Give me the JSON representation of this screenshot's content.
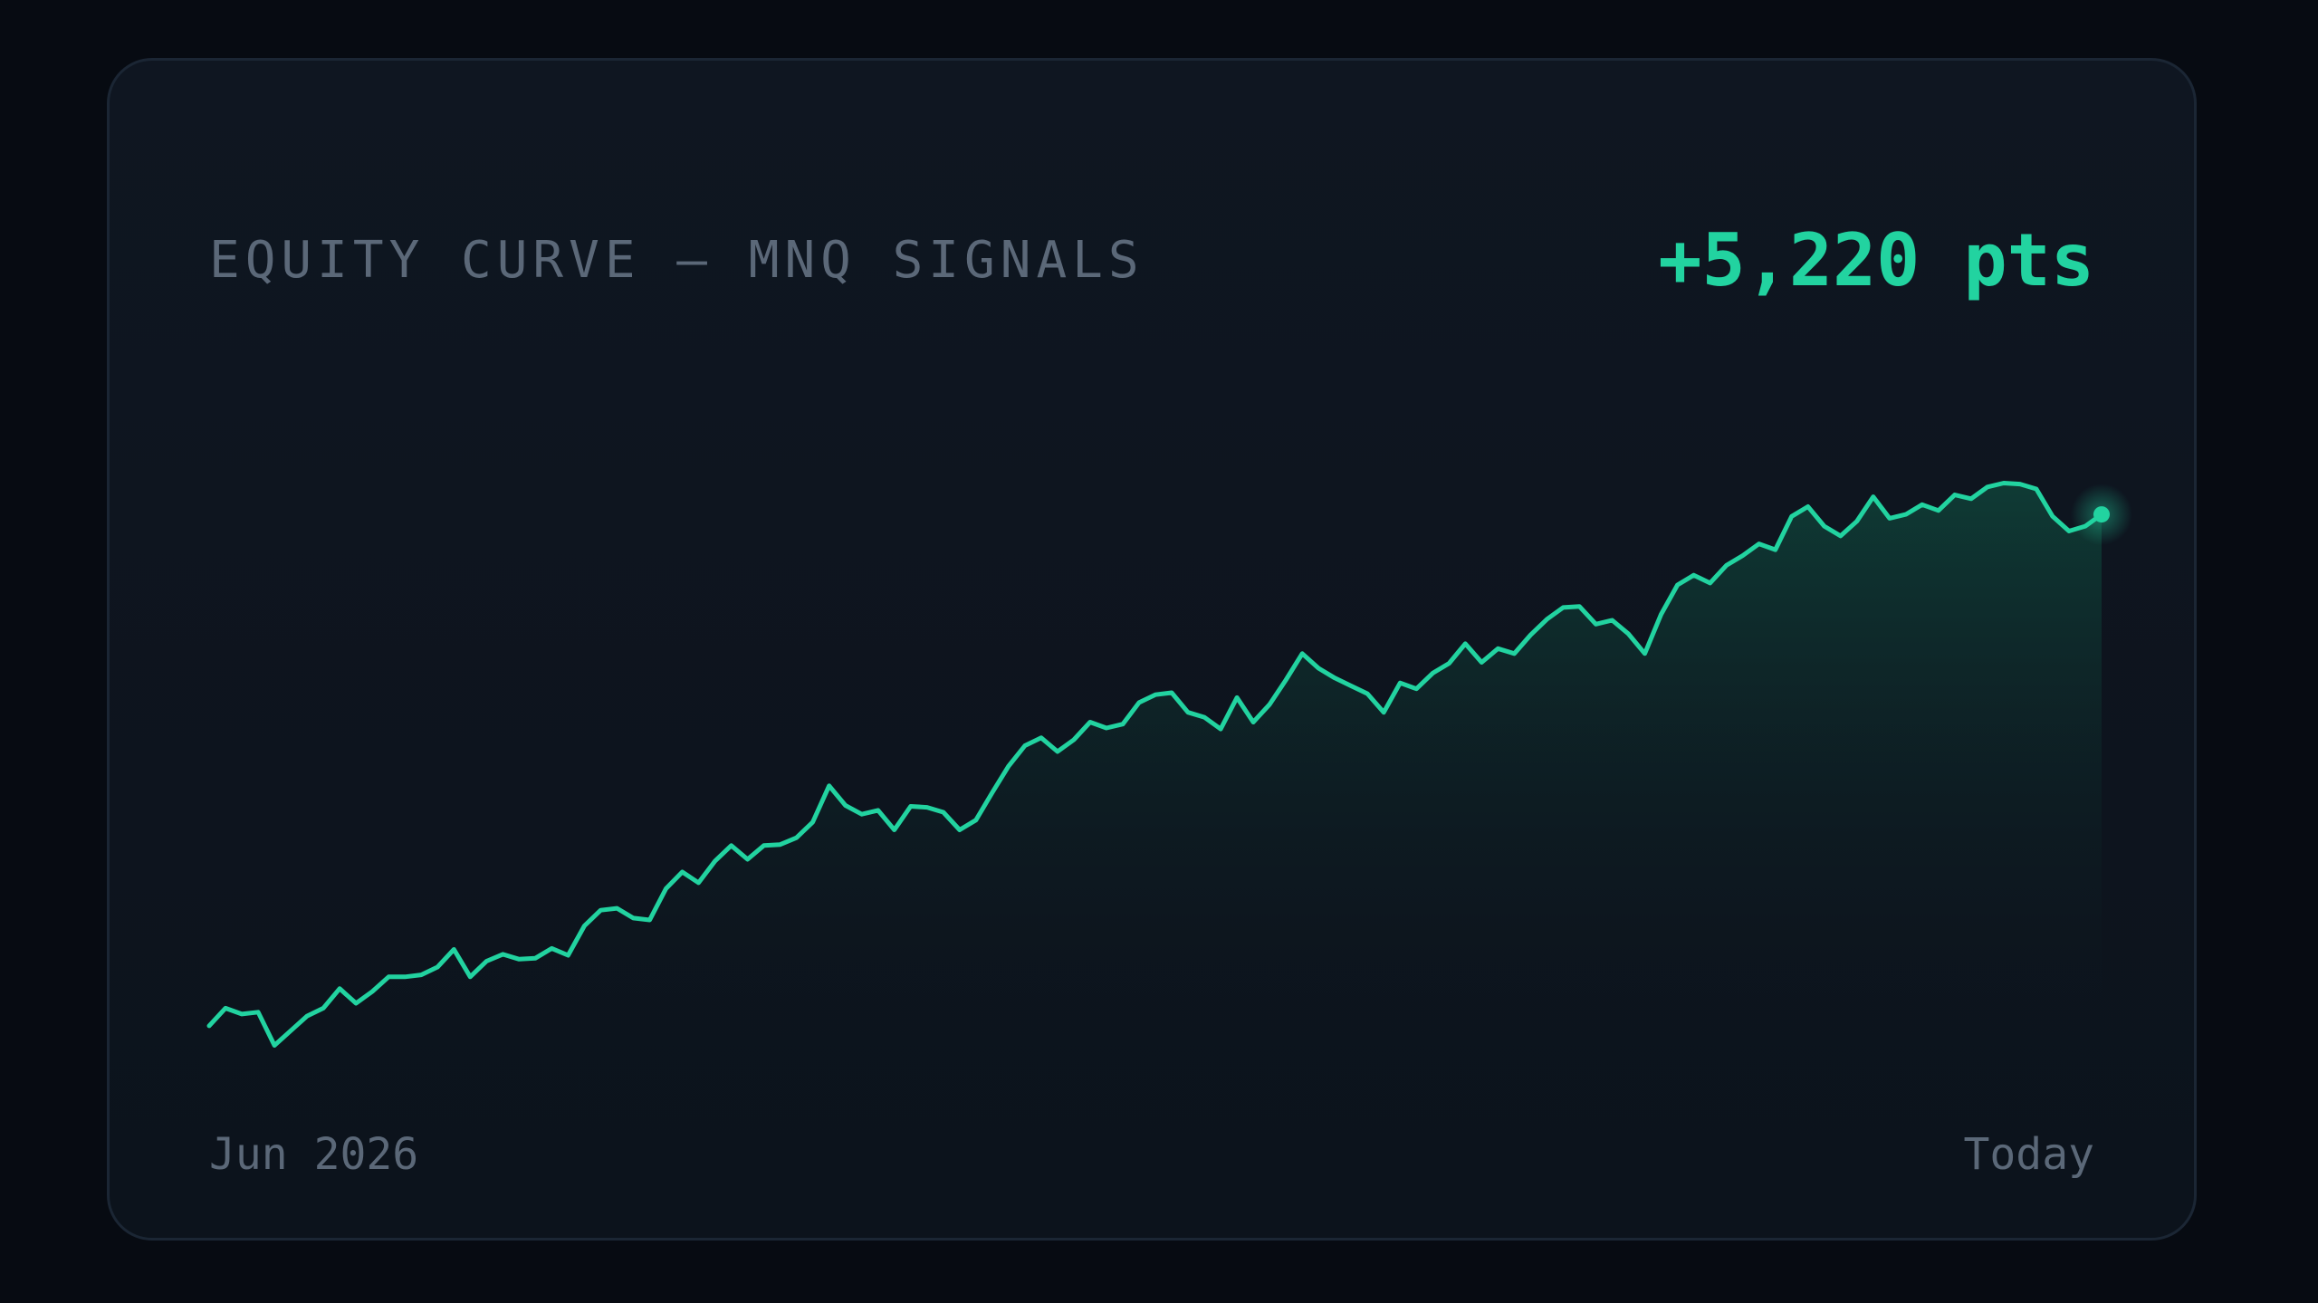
{
  "card": {
    "title": "EQUITY CURVE — MNQ SIGNALS",
    "total": "+5,220 pts"
  },
  "colors": {
    "background": "#070b12",
    "card": "#0f1621",
    "line": "#22d3a0",
    "label": "#5b6878"
  },
  "chart_data": {
    "type": "area",
    "xlabel": "",
    "ylabel": "",
    "x_tick_labels": [
      "Jun 2026",
      "Today"
    ],
    "grid": false,
    "legend": "none",
    "ylim": [
      -500,
      5600
    ],
    "series": [
      {
        "values": [
          0,
          180,
          120,
          140,
          -200,
          -50,
          100,
          180,
          380,
          230,
          350,
          500,
          500,
          520,
          600,
          780,
          500,
          660,
          730,
          680,
          690,
          790,
          720,
          1020,
          1180,
          1200,
          1100,
          1080,
          1400,
          1570,
          1460,
          1680,
          1840,
          1700,
          1840,
          1850,
          1920,
          2080,
          2450,
          2250,
          2160,
          2200,
          2000,
          2240,
          2230,
          2180,
          2000,
          2100,
          2380,
          2650,
          2860,
          2940,
          2800,
          2920,
          3100,
          3040,
          3080,
          3300,
          3380,
          3400,
          3200,
          3150,
          3030,
          3350,
          3100,
          3280,
          3530,
          3800,
          3650,
          3550,
          3470,
          3390,
          3200,
          3500,
          3440,
          3600,
          3700,
          3900,
          3710,
          3850,
          3800,
          3990,
          4150,
          4270,
          4280,
          4100,
          4140,
          4000,
          3800,
          4200,
          4500,
          4600,
          4520,
          4700,
          4800,
          4920,
          4860,
          5200,
          5300,
          5100,
          5000,
          5150,
          5400,
          5180,
          5220,
          5320,
          5260,
          5420,
          5380,
          5500,
          5540,
          5530,
          5480,
          5200,
          5050,
          5100,
          5220
        ]
      }
    ]
  }
}
